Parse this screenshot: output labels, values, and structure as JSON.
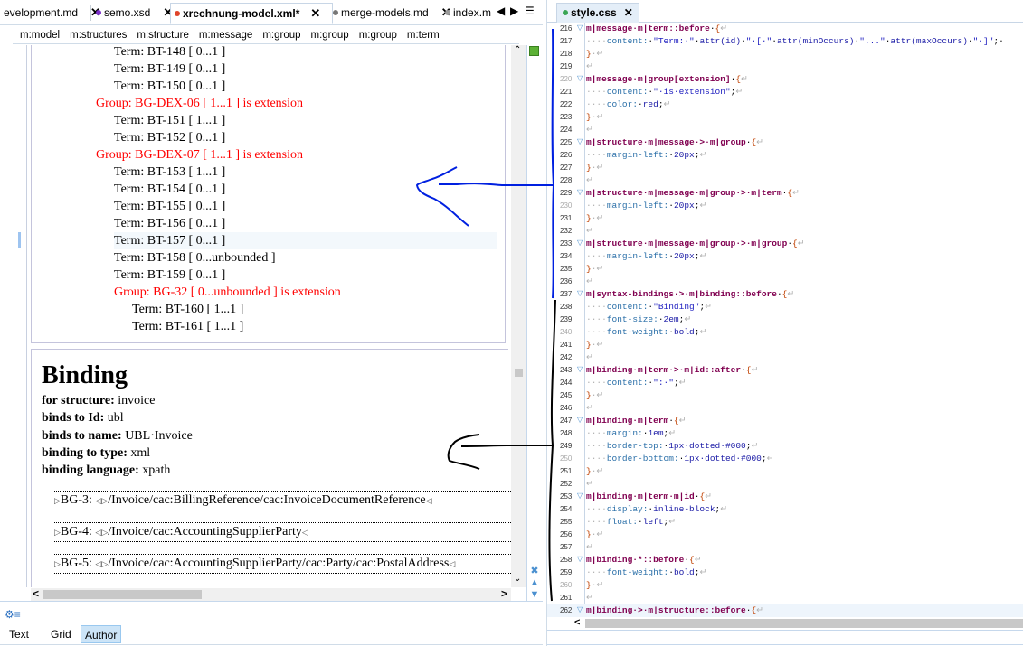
{
  "left_editor": {
    "tabs": [
      {
        "label": "evelopment.md",
        "dot_color": null,
        "active": false
      },
      {
        "label": "semo.xsd",
        "dot_color": "#7b2fc9",
        "active": false
      },
      {
        "label": "xrechnung-model.xml*",
        "dot_color": "#e0442a",
        "active": true
      },
      {
        "label": "merge-models.md",
        "dot_color": "#777777",
        "active": false
      },
      {
        "label": "index.m",
        "dot_color": "#999999",
        "active": false
      }
    ],
    "tab_close_glyph": "✕",
    "nav": {
      "prev": "◀",
      "next": "▶",
      "menu": "☰"
    },
    "breadcrumb": [
      "m:model",
      "m:structures",
      "m:structure",
      "m:message",
      "m:group",
      "m:group",
      "m:group",
      "m:term"
    ],
    "tree_rows": [
      {
        "text": "Term: BT-148 [ 0...1 ]",
        "type": "term",
        "level": 2
      },
      {
        "text": "Term: BT-149 [ 0...1 ]",
        "type": "term",
        "level": 2
      },
      {
        "text": "Term: BT-150 [ 0...1 ]",
        "type": "term",
        "level": 2
      },
      {
        "text": "Group: BG-DEX-06 [ 1...1 ] is extension",
        "type": "group",
        "level": 1
      },
      {
        "text": "Term: BT-151 [ 1...1 ]",
        "type": "term",
        "level": 2
      },
      {
        "text": "Term: BT-152 [ 0...1 ]",
        "type": "term",
        "level": 2
      },
      {
        "text": "Group: BG-DEX-07 [ 1...1 ] is extension",
        "type": "group",
        "level": 1
      },
      {
        "text": "Term: BT-153 [ 1...1 ]",
        "type": "term",
        "level": 2
      },
      {
        "text": "Term: BT-154 [ 0...1 ]",
        "type": "term",
        "level": 2
      },
      {
        "text": "Term: BT-155 [ 0...1 ]",
        "type": "term",
        "level": 2
      },
      {
        "text": "Term: BT-156 [ 0...1 ]",
        "type": "term",
        "level": 2
      },
      {
        "text": "Term: BT-157 [ 0...1 ]",
        "type": "term",
        "level": 2,
        "highlighted": true
      },
      {
        "text": "Term: BT-158 [ 0...unbounded ]",
        "type": "term",
        "level": 2
      },
      {
        "text": "Term: BT-159 [ 0...1 ]",
        "type": "term",
        "level": 2
      },
      {
        "text": "Group: BG-32 [ 0...unbounded ] is extension",
        "type": "group",
        "level": 2
      },
      {
        "text": "Term: BT-160 [ 1...1 ]",
        "type": "term",
        "level": 3
      },
      {
        "text": "Term: BT-161 [ 1...1 ]",
        "type": "term",
        "level": 3
      }
    ],
    "binding": {
      "title": "Binding",
      "props": [
        {
          "label": "for structure:",
          "value": "invoice"
        },
        {
          "label": "binds to Id:",
          "value": "ubl"
        },
        {
          "label": "binds to name:",
          "value": "UBL·Invoice"
        },
        {
          "label": "binding to type:",
          "value": "xml"
        },
        {
          "label": "binding language:",
          "value": "xpath"
        }
      ],
      "terms": [
        {
          "id": "BG-3:",
          "path": "/Invoice/cac:BillingReference/cac:InvoiceDocumentReference"
        },
        {
          "id": "BG-4:",
          "path": "/Invoice/cac:AccountingSupplierParty"
        },
        {
          "id": "BG-5:",
          "path": "/Invoice/cac:AccountingSupplierParty/cac:Party/cac:PostalAddress"
        }
      ]
    },
    "modes": [
      {
        "label": "Text",
        "active": false
      },
      {
        "label": "Grid",
        "active": false
      },
      {
        "label": "Author",
        "active": true
      }
    ],
    "colors": {
      "group_red": "#ff0000",
      "status_green": "#5cb135"
    }
  },
  "right_editor": {
    "tab": {
      "label": "style.css",
      "dot_color": "#3aa655",
      "close": "✕"
    },
    "lines": [
      {
        "n": 216,
        "fold": true,
        "html": "<span class='sel'>m|message·m|term::before</span>·<span class='brace'>{</span><span class='ws'>↵</span>"
      },
      {
        "n": 217,
        "html": "<span class='ws'>····</span><span class='prop-c'>content:</span>·<span class='str'>\"Term:·\"</span>·<span class='val'>attr(id)</span>·<span class='str'>\"·[·\"</span>·<span class='val'>attr(minOccurs)</span>·<span class='str'>\"...\"</span>·<span class='val'>attr(maxOccurs)</span>·<span class='str'>\"·]\"</span>;·"
      },
      {
        "n": 218,
        "html": "<span class='brace'>}</span><span class='ws'>·↵</span>"
      },
      {
        "n": 219,
        "html": "<span class='ws'>↵</span>"
      },
      {
        "n": 220,
        "fold": true,
        "faint": true,
        "html": "<span class='sel'>m|message·m|group[extension]</span>·<span class='brace'>{</span><span class='ws'>↵</span>"
      },
      {
        "n": 221,
        "html": "<span class='ws'>····</span><span class='prop-c'>content:</span>·<span class='str'>\"·is·extension\"</span>;<span class='ws'>↵</span>"
      },
      {
        "n": 222,
        "html": "<span class='ws'>····</span><span class='prop-c'>color:</span>·<span class='val'>red</span>;<span class='ws'>↵</span>"
      },
      {
        "n": 223,
        "html": "<span class='brace'>}</span><span class='ws'>·↵</span>"
      },
      {
        "n": 224,
        "html": "<span class='ws'>↵</span>"
      },
      {
        "n": 225,
        "fold": true,
        "html": "<span class='sel'>m|structure·m|message·&gt;·m|group</span>·<span class='brace'>{</span><span class='ws'>↵</span>"
      },
      {
        "n": 226,
        "html": "<span class='ws'>····</span><span class='prop-c'>margin-left:</span>·<span class='val'>20px</span>;<span class='ws'>↵</span>"
      },
      {
        "n": 227,
        "html": "<span class='brace'>}</span><span class='ws'>·↵</span>"
      },
      {
        "n": 228,
        "html": "<span class='ws'>↵</span>"
      },
      {
        "n": 229,
        "fold": true,
        "html": "<span class='sel'>m|structure·m|message·m|group·&gt;·m|term</span>·<span class='brace'>{</span><span class='ws'>↵</span>"
      },
      {
        "n": 230,
        "faint": true,
        "html": "<span class='ws'>····</span><span class='prop-c'>margin-left:</span>·<span class='val'>20px</span>;<span class='ws'>↵</span>"
      },
      {
        "n": 231,
        "html": "<span class='brace'>}</span><span class='ws'>·↵</span>"
      },
      {
        "n": 232,
        "html": "<span class='ws'>↵</span>"
      },
      {
        "n": 233,
        "fold": true,
        "html": "<span class='sel'>m|structure·m|message·m|group·&gt;·m|group</span>·<span class='brace'>{</span><span class='ws'>↵</span>"
      },
      {
        "n": 234,
        "html": "<span class='ws'>····</span><span class='prop-c'>margin-left:</span>·<span class='val'>20px</span>;<span class='ws'>↵</span>"
      },
      {
        "n": 235,
        "html": "<span class='brace'>}</span><span class='ws'>·↵</span>"
      },
      {
        "n": 236,
        "html": "<span class='ws'>↵</span>"
      },
      {
        "n": 237,
        "fold": true,
        "html": "<span class='sel'>m|syntax-bindings·&gt;·m|binding::before</span>·<span class='brace'>{</span><span class='ws'>↵</span>"
      },
      {
        "n": 238,
        "html": "<span class='ws'>····</span><span class='prop-c'>content:</span>·<span class='str'>\"Binding\"</span>;<span class='ws'>↵</span>"
      },
      {
        "n": 239,
        "html": "<span class='ws'>····</span><span class='prop-c'>font-size:</span>·<span class='val'>2em</span>;<span class='ws'>↵</span>"
      },
      {
        "n": 240,
        "faint": true,
        "html": "<span class='ws'>····</span><span class='prop-c'>font-weight:</span>·<span class='val'>bold</span>;<span class='ws'>↵</span>"
      },
      {
        "n": 241,
        "html": "<span class='brace'>}</span><span class='ws'>·↵</span>"
      },
      {
        "n": 242,
        "html": "<span class='ws'>↵</span>"
      },
      {
        "n": 243,
        "fold": true,
        "html": "<span class='sel'>m|binding·m|term·&gt;·m|id::after</span>·<span class='brace'>{</span><span class='ws'>↵</span>"
      },
      {
        "n": 244,
        "html": "<span class='ws'>····</span><span class='prop-c'>content:</span>·<span class='str'>\":·\"</span>;<span class='ws'>↵</span>"
      },
      {
        "n": 245,
        "html": "<span class='brace'>}</span><span class='ws'>·↵</span>"
      },
      {
        "n": 246,
        "html": "<span class='ws'>↵</span>"
      },
      {
        "n": 247,
        "fold": true,
        "html": "<span class='sel'>m|binding·m|term</span>·<span class='brace'>{</span><span class='ws'>↵</span>"
      },
      {
        "n": 248,
        "html": "<span class='ws'>····</span><span class='prop-c'>margin:</span>·<span class='val'>1em</span>;<span class='ws'>↵</span>"
      },
      {
        "n": 249,
        "html": "<span class='ws'>····</span><span class='prop-c'>border-top:</span>·<span class='val'>1px·dotted·#000</span>;<span class='ws'>↵</span>"
      },
      {
        "n": 250,
        "faint": true,
        "html": "<span class='ws'>····</span><span class='prop-c'>border-bottom:</span>·<span class='val'>1px·dotted·#000</span>;<span class='ws'>↵</span>"
      },
      {
        "n": 251,
        "html": "<span class='brace'>}</span><span class='ws'>·↵</span>"
      },
      {
        "n": 252,
        "html": "<span class='ws'>↵</span>"
      },
      {
        "n": 253,
        "fold": true,
        "html": "<span class='sel'>m|binding·m|term·m|id</span>·<span class='brace'>{</span><span class='ws'>↵</span>"
      },
      {
        "n": 254,
        "html": "<span class='ws'>····</span><span class='prop-c'>display:</span>·<span class='val'>inline-block</span>;<span class='ws'>↵</span>"
      },
      {
        "n": 255,
        "html": "<span class='ws'>····</span><span class='prop-c'>float:</span>·<span class='val'>left</span>;<span class='ws'>↵</span>"
      },
      {
        "n": 256,
        "html": "<span class='brace'>}</span><span class='ws'>·↵</span>"
      },
      {
        "n": 257,
        "html": "<span class='ws'>↵</span>"
      },
      {
        "n": 258,
        "fold": true,
        "html": "<span class='sel'>m|binding·*::before</span>·<span class='brace'>{</span><span class='ws'>↵</span>"
      },
      {
        "n": 259,
        "html": "<span class='ws'>····</span><span class='prop-c'>font-weight:</span>·<span class='val'>bold</span>;<span class='ws'>↵</span>"
      },
      {
        "n": 260,
        "faint": true,
        "html": "<span class='brace'>}</span><span class='ws'>·↵</span>"
      },
      {
        "n": 261,
        "html": "<span class='ws'>↵</span>"
      },
      {
        "n": 262,
        "fold": true,
        "current": true,
        "html": "<span class='sel'>m|binding·&gt;·m|structure::before</span>·<span class='brace'>{</span><span class='ws'>↵</span>"
      }
    ]
  },
  "annotations": {
    "blue_color": "#0020e0",
    "black_color": "#000000"
  }
}
